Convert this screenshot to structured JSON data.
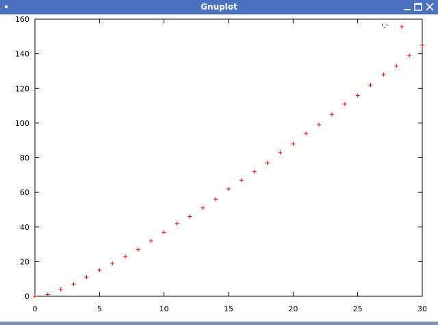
{
  "window": {
    "title": "Gnuplot",
    "controls": [
      "minimize-icon",
      "maximize-icon",
      "close-icon"
    ]
  },
  "chart_data": {
    "type": "scatter",
    "title": "",
    "xlabel": "",
    "ylabel": "",
    "xlim": [
      0,
      30
    ],
    "ylim": [
      0,
      160
    ],
    "x_ticks": [
      0,
      5,
      10,
      15,
      20,
      25,
      30
    ],
    "y_ticks": [
      0,
      20,
      40,
      60,
      80,
      100,
      120,
      140,
      160
    ],
    "grid": false,
    "legend": {
      "position": "top-right",
      "entries": [
        "'-'"
      ]
    },
    "series": [
      {
        "name": "'-'",
        "color": "#ff0000",
        "marker": "plus",
        "x": [
          0,
          1,
          2,
          3,
          4,
          5,
          6,
          7,
          8,
          9,
          10,
          11,
          12,
          13,
          14,
          15,
          16,
          17,
          18,
          19,
          20,
          21,
          22,
          23,
          24,
          25,
          26,
          27,
          28,
          29,
          30
        ],
        "y": [
          0,
          1,
          4,
          7,
          11,
          15,
          19,
          23,
          27,
          32,
          37,
          42,
          46,
          51,
          56,
          62,
          67,
          72,
          77,
          83,
          88,
          94,
          99,
          105,
          111,
          116,
          122,
          128,
          133,
          139,
          145
        ]
      }
    ]
  }
}
